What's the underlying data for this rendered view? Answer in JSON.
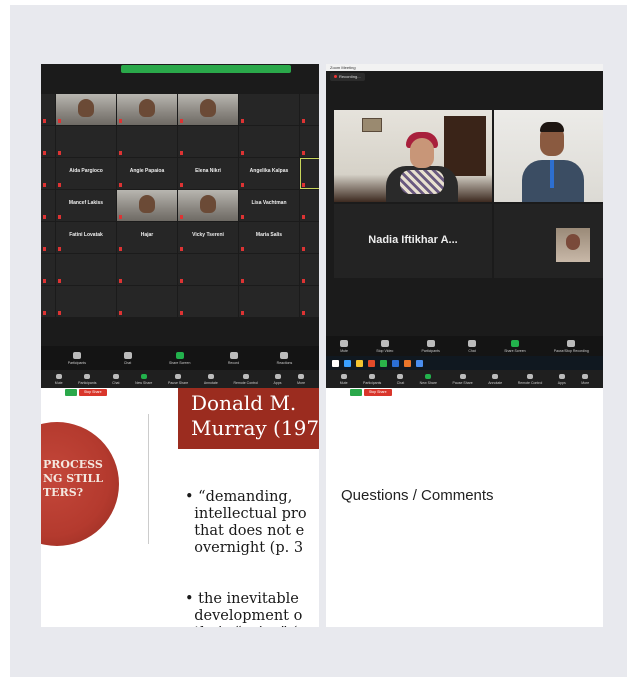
{
  "gallery": {
    "banner": "",
    "tiles": [
      {
        "label": "",
        "video": true
      },
      {
        "label": "",
        "video": true
      },
      {
        "label": "",
        "video": true
      },
      {
        "label": "",
        "video": false
      },
      {
        "label": "",
        "video": false
      },
      {
        "label": "",
        "video": false
      },
      {
        "label": "",
        "video": false
      },
      {
        "label": "",
        "video": false
      },
      {
        "label": "Aida Pargioco",
        "video": false
      },
      {
        "label": "Angie Papaioa",
        "video": false
      },
      {
        "label": "Elena Nikri",
        "video": false
      },
      {
        "label": "Angelika Kalpas",
        "video": false
      },
      {
        "label": "Mancef Lakiss",
        "video": false
      },
      {
        "label": "",
        "video": true
      },
      {
        "label": "",
        "video": true
      },
      {
        "label": "Lisa Vachtman",
        "video": false
      },
      {
        "label": "Fatini Lovatak",
        "video": false
      },
      {
        "label": "Hajar",
        "video": false
      },
      {
        "label": "Vicky Tsereni",
        "video": false
      },
      {
        "label": "Maria Salis",
        "video": false
      }
    ],
    "toolbar": [
      "Participants",
      "Chat",
      "Share Screen",
      "Record",
      "Reactions"
    ]
  },
  "speaker_view": {
    "title": "Zoom Meeting",
    "recording": "Recording...",
    "big_name": "Nadia Iftikhar A...",
    "tile1_name": "",
    "tile2_name": "",
    "tile3_name": "",
    "tile4_name": "",
    "toolbar": [
      "Mute",
      "Stop Video",
      "Participants",
      "Chat",
      "Share Screen",
      "Pause/Stop Recording"
    ]
  },
  "share_left": {
    "toolbar": [
      "Mute",
      "Participants",
      "Chat",
      "New Share",
      "Pause Share",
      "Annotate",
      "Remote Control",
      "Apps",
      "More"
    ],
    "sharing_text": "",
    "stop_label": "Stop Share"
  },
  "slide": {
    "circle_text": "PROCESS\nNG STILL\nTERS?",
    "title": "Donald M.\nMurray (197",
    "bullets": [
      "• “demanding,\n  intellectual pro\n  that does not e\n  overnight (p. 3",
      "• the inevitable\n  development o\n  their “voice” (p"
    ]
  },
  "share_right": {
    "toolbar": [
      "Mute",
      "Participants",
      "Chat",
      "New Share",
      "Pause Share",
      "Annotate",
      "Remote Control",
      "Apps",
      "More"
    ],
    "sharing_text": "",
    "stop_label": "Stop Share",
    "body_text": "Questions / Comments"
  }
}
